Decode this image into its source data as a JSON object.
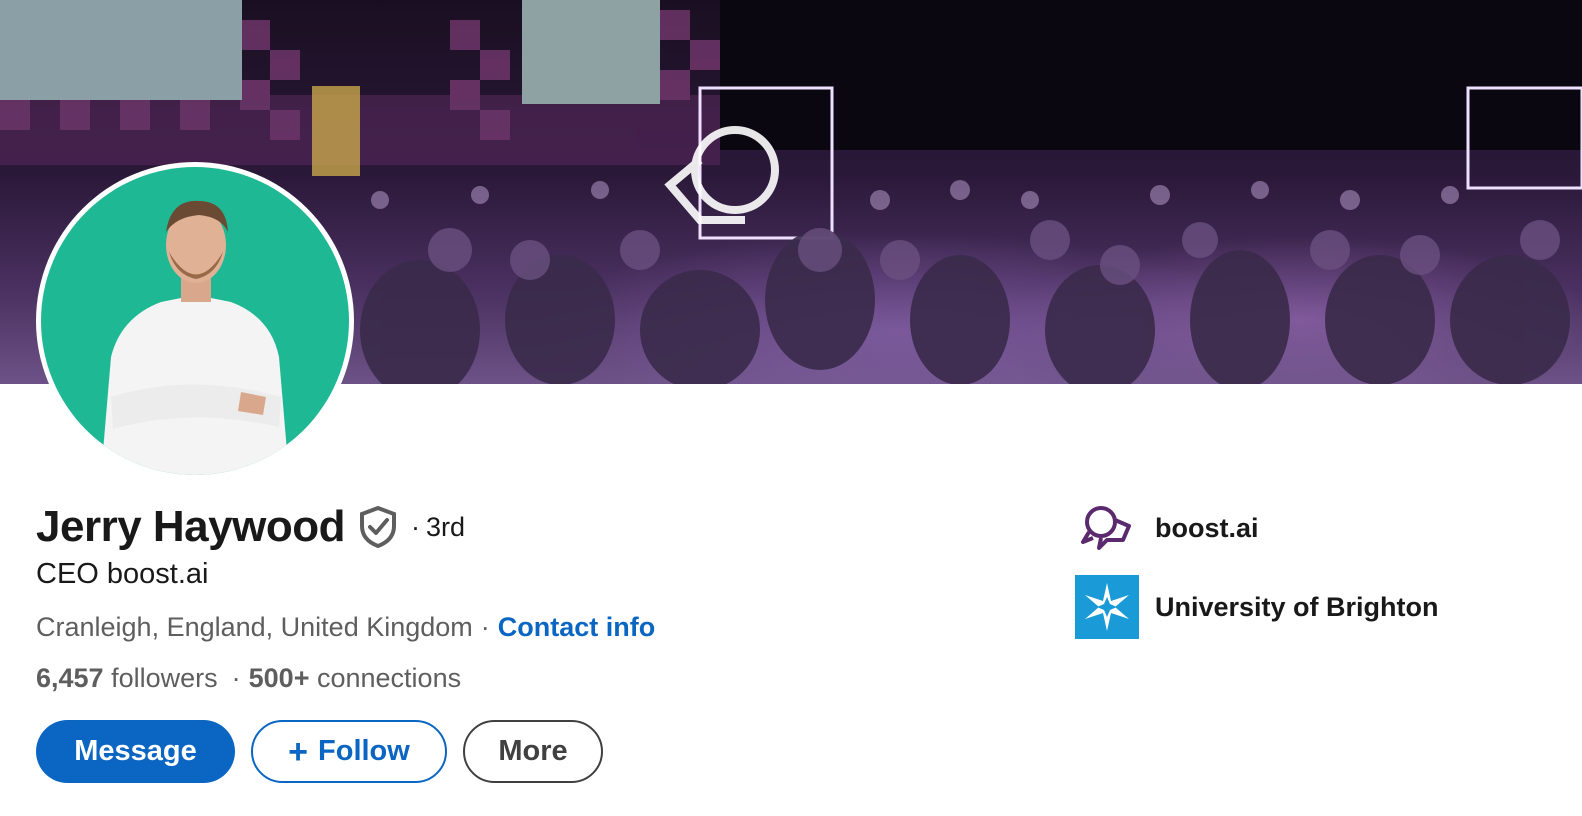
{
  "profile": {
    "name": "Jerry Haywood",
    "degree_separator": "·",
    "degree": "3rd",
    "headline": "CEO boost.ai",
    "location": "Cranleigh, England, United Kingdom",
    "location_separator": "·",
    "contact_info_label": "Contact info",
    "followers_count": "6,457",
    "followers_label": "followers",
    "stats_separator": "·",
    "connections_count": "500+",
    "connections_label": "connections"
  },
  "actions": {
    "message_label": "Message",
    "follow_plus": "+",
    "follow_label": "Follow",
    "more_label": "More"
  },
  "organizations": [
    {
      "name": "boost.ai",
      "icon": "boost-ai-logo-icon"
    },
    {
      "name": "University of Brighton",
      "icon": "university-of-brighton-logo-icon"
    }
  ],
  "colors": {
    "primary_blue": "#0a66c2",
    "avatar_bg": "#1fb894",
    "boost_purple": "#5b2a6e",
    "brighton_blue": "#1a9bd7"
  }
}
